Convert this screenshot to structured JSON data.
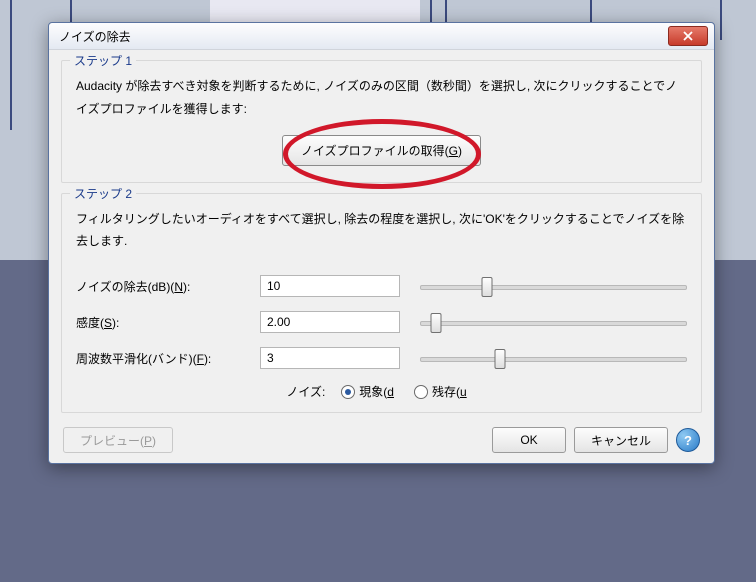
{
  "window": {
    "title": "ノイズの除去"
  },
  "step1": {
    "legend": "ステップ 1",
    "text": "Audacity が除去すべき対象を判断するために, ノイズのみの区間（数秒間）を選択し, 次にクリックすることでノイズプロファイルを獲得します:",
    "button_label": "ノイズプロファイルの取得(",
    "button_key": "G",
    "button_label_end": ")"
  },
  "step2": {
    "legend": "ステップ 2",
    "text": "フィルタリングしたいオーディオをすべて選択し, 除去の程度を選択し, 次に'OK'をクリックすることでノイズを除去します.",
    "noise_db": {
      "label_pre": "ノイズの除去(dB)(",
      "key": "N",
      "label_post": "):",
      "value": "10",
      "slider_pct": 25
    },
    "sensitivity": {
      "label_pre": "感度(",
      "key": "S",
      "label_post": "):",
      "value": "2.00",
      "slider_pct": 6
    },
    "freq": {
      "label_pre": "周波数平滑化(バンド)(",
      "key": "F",
      "label_post": "):",
      "value": "3",
      "slider_pct": 30
    },
    "radio": {
      "label": "ノイズ:",
      "opt1_pre": "現象(",
      "opt1_key": "d",
      "opt2_pre": "残存(",
      "opt2_key": "u"
    }
  },
  "buttons": {
    "preview_pre": "プレビュー(",
    "preview_key": "P",
    "preview_post": ")",
    "ok": "OK",
    "cancel": "キャンセル",
    "help": "?"
  }
}
